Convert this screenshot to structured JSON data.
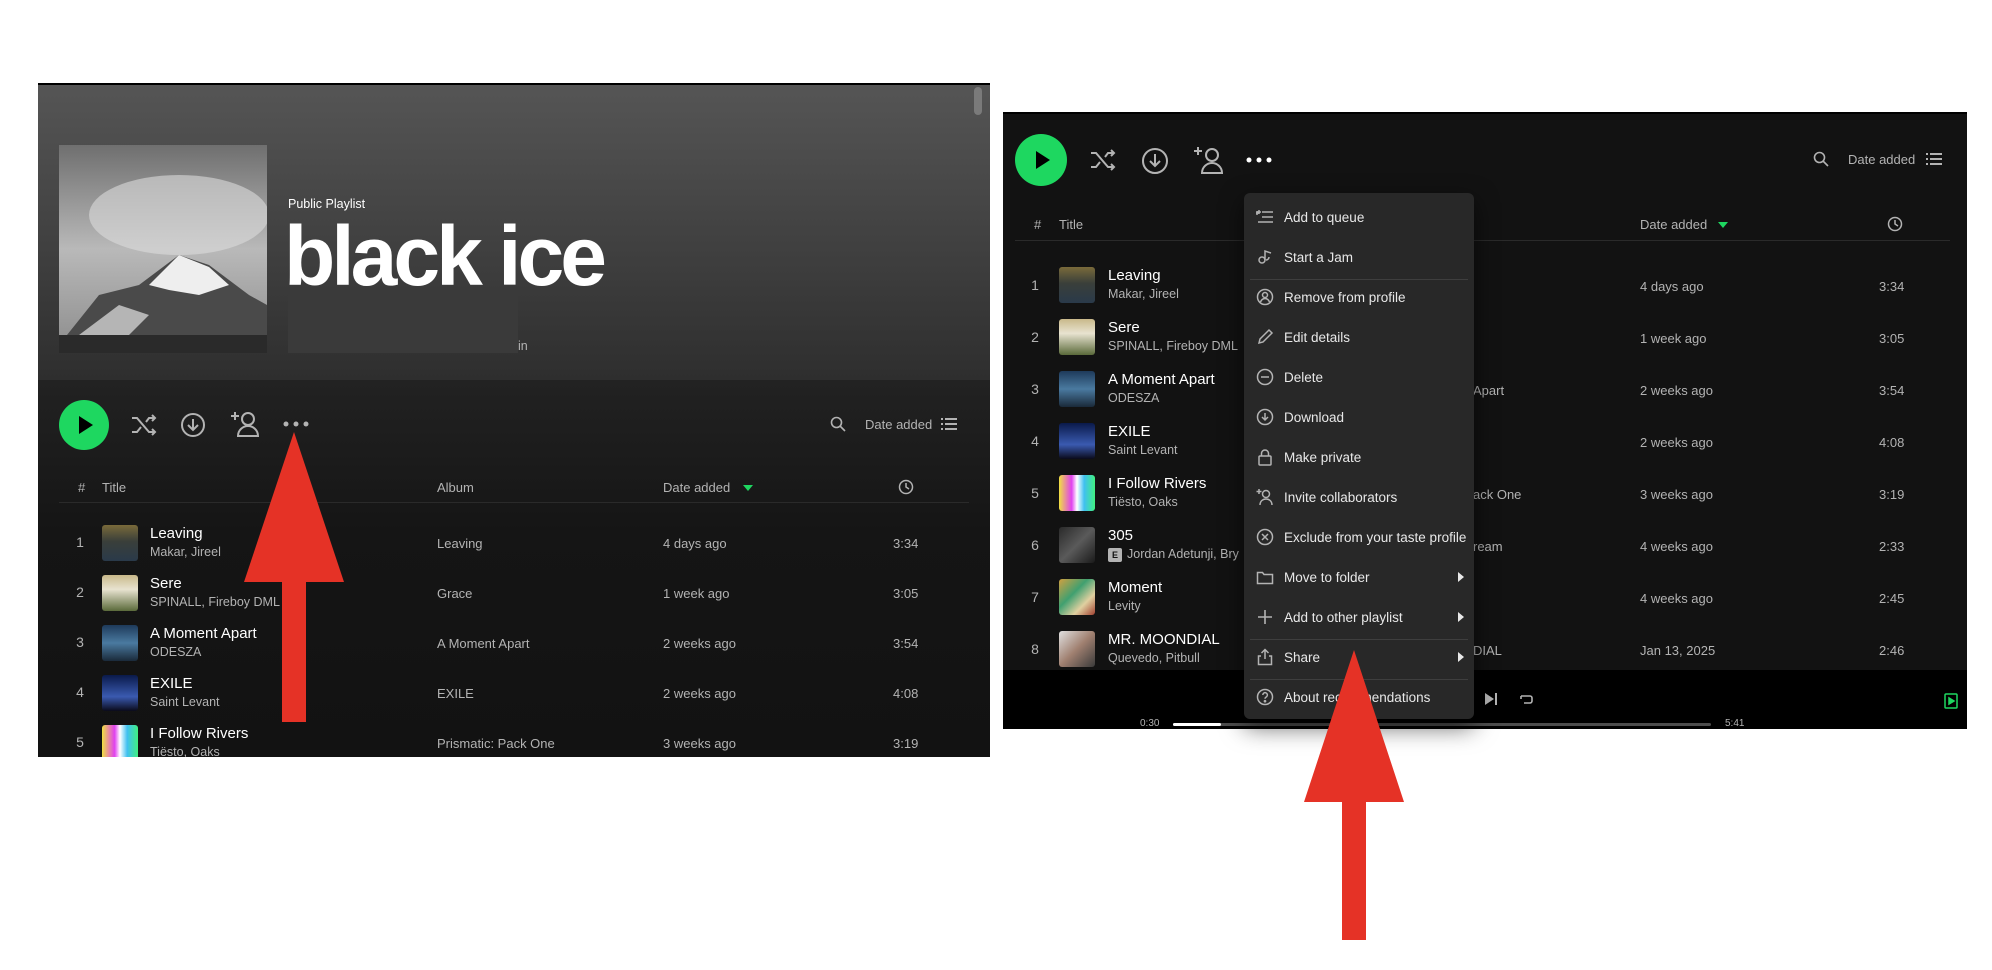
{
  "left_panel": {
    "playlist_type": "Public Playlist",
    "playlist_title": "black ice",
    "meta_fragment": "in",
    "sort_label": "Date added",
    "table_headers": {
      "num": "#",
      "title": "Title",
      "album": "Album",
      "date": "Date added"
    },
    "tracks": [
      {
        "num": "1",
        "title": "Leaving",
        "artist": "Makar, Jireel",
        "album": "Leaving",
        "date": "4 days ago",
        "duration": "3:34"
      },
      {
        "num": "2",
        "title": "Sere",
        "artist": "SPINALL, Fireboy DML",
        "album": "Grace",
        "date": "1 week ago",
        "duration": "3:05"
      },
      {
        "num": "3",
        "title": "A Moment Apart",
        "artist": "ODESZA",
        "album": "A Moment Apart",
        "date": "2 weeks ago",
        "duration": "3:54"
      },
      {
        "num": "4",
        "title": "EXILE",
        "artist": "Saint Levant",
        "album": "EXILE",
        "date": "2 weeks ago",
        "duration": "4:08"
      },
      {
        "num": "5",
        "title": "I Follow Rivers",
        "artist": "Tiësto, Oaks",
        "album": "Prismatic: Pack One",
        "date": "3 weeks ago",
        "duration": "3:19"
      }
    ]
  },
  "right_panel": {
    "sort_label": "Date added",
    "table_headers": {
      "num": "#",
      "title": "Title",
      "date": "Date added"
    },
    "tracks": [
      {
        "num": "1",
        "title": "Leaving",
        "artist": "Makar, Jireel",
        "album_fragment": "",
        "date": "4 days ago",
        "duration": "3:34"
      },
      {
        "num": "2",
        "title": "Sere",
        "artist": "SPINALL, Fireboy DML",
        "album_fragment": "",
        "date": "1 week ago",
        "duration": "3:05"
      },
      {
        "num": "3",
        "title": "A Moment Apart",
        "artist": "ODESZA",
        "album_fragment": "Apart",
        "date": "2 weeks ago",
        "duration": "3:54"
      },
      {
        "num": "4",
        "title": "EXILE",
        "artist": "Saint Levant",
        "album_fragment": "",
        "date": "2 weeks ago",
        "duration": "4:08"
      },
      {
        "num": "5",
        "title": "I Follow Rivers",
        "artist": "Tiësto, Oaks",
        "album_fragment": "ack One",
        "date": "3 weeks ago",
        "duration": "3:19"
      },
      {
        "num": "6",
        "title": "305",
        "artist": "Jordan Adetunji, Bry",
        "explicit": "E",
        "album_fragment": "ream",
        "date": "4 weeks ago",
        "duration": "2:33"
      },
      {
        "num": "7",
        "title": "Moment",
        "artist": "Levity",
        "album_fragment": "",
        "date": "4 weeks ago",
        "duration": "2:45"
      },
      {
        "num": "8",
        "title": "MR. MOONDIAL",
        "artist": "Quevedo, Pitbull",
        "album_fragment": "DIAL",
        "date": "Jan 13, 2025",
        "duration": "2:46"
      }
    ],
    "player": {
      "elapsed": "0:30",
      "total": "5:41"
    },
    "context_menu": [
      {
        "label": "Add to queue",
        "icon": "add-to-queue-icon"
      },
      {
        "label": "Start a Jam",
        "icon": "jam-icon"
      },
      {
        "label": "Remove from profile",
        "icon": "profile-icon"
      },
      {
        "label": "Edit details",
        "icon": "pencil-icon"
      },
      {
        "label": "Delete",
        "icon": "minus-circle-icon"
      },
      {
        "label": "Download",
        "icon": "download-icon"
      },
      {
        "label": "Make private",
        "icon": "lock-icon"
      },
      {
        "label": "Invite collaborators",
        "icon": "add-user-icon"
      },
      {
        "label": "Exclude from your taste profile",
        "icon": "x-circle-icon"
      },
      {
        "label": "Move to folder",
        "icon": "folder-icon",
        "submenu": true
      },
      {
        "label": "Add to other playlist",
        "icon": "plus-icon",
        "submenu": true
      },
      {
        "label": "Share",
        "icon": "share-icon",
        "submenu": true
      },
      {
        "label": "About recommendations",
        "icon": "question-icon"
      }
    ]
  },
  "colors": {
    "accent_green": "#1ed760",
    "arrow_red": "#e53226",
    "background": "#121212",
    "menu_bg": "#282828"
  }
}
